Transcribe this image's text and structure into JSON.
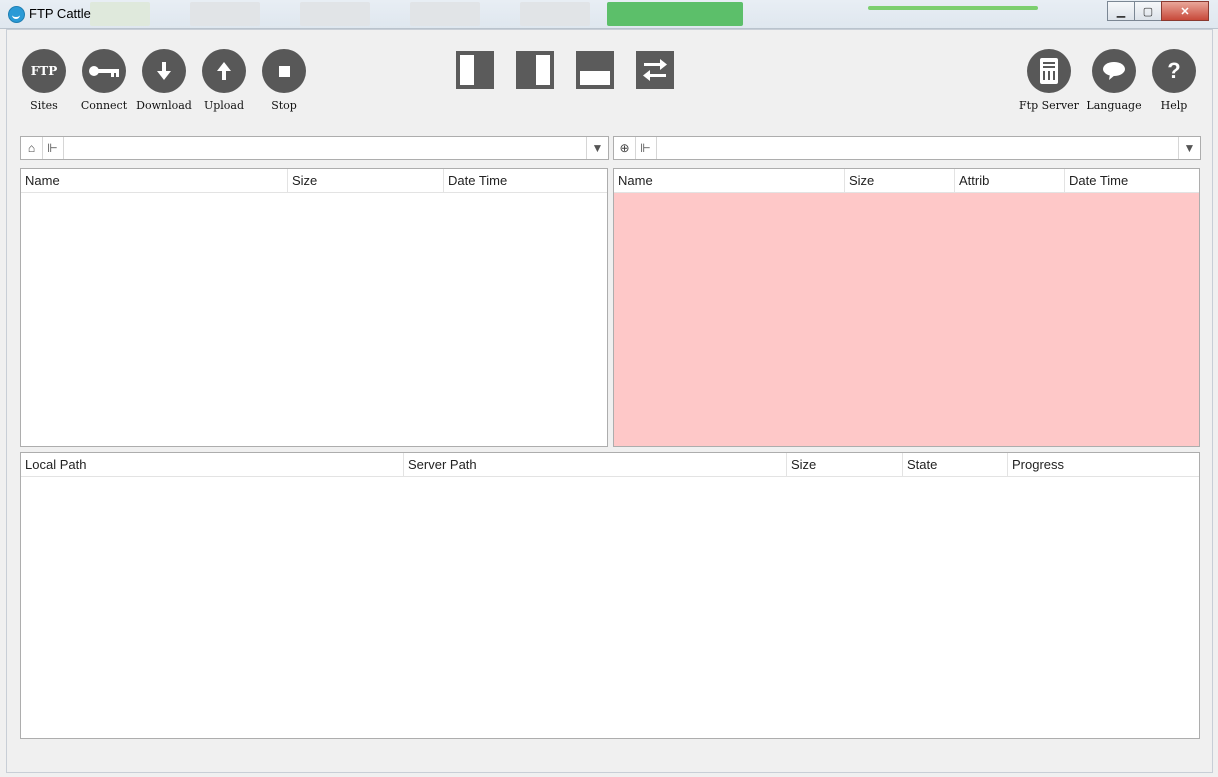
{
  "window": {
    "title": "FTP Cattle",
    "controls": [
      "minimize",
      "maximize",
      "close"
    ]
  },
  "toolbar": {
    "left": [
      {
        "label": "Sites",
        "icon": "ftp-icon",
        "glyph": "FTP"
      },
      {
        "label": "Connect",
        "icon": "key-icon",
        "glyph": "⚷"
      },
      {
        "label": "Download",
        "icon": "download-arrow-icon",
        "glyph": "⬇"
      },
      {
        "label": "Upload",
        "icon": "upload-arrow-icon",
        "glyph": "⬆"
      },
      {
        "label": "Stop",
        "icon": "stop-icon",
        "glyph": "■"
      }
    ],
    "layout_buttons": [
      "left-pane-layout",
      "right-pane-layout",
      "bottom-pane-layout",
      "swap-panes"
    ],
    "right": [
      {
        "label": "Ftp Server",
        "icon": "server-icon",
        "glyph": "▤"
      },
      {
        "label": "Language",
        "icon": "speech-bubble-icon",
        "glyph": "●"
      },
      {
        "label": "Help",
        "icon": "help-icon",
        "glyph": "?"
      }
    ]
  },
  "local": {
    "path_value": "",
    "columns": [
      "Name",
      "Size",
      "Date Time"
    ]
  },
  "remote": {
    "path_value": "",
    "columns": [
      "Name",
      "Size",
      "Attrib",
      "Date Time"
    ],
    "background": "#fec8c8"
  },
  "queue": {
    "columns": [
      "Local Path",
      "Server Path",
      "Size",
      "State",
      "Progress"
    ]
  }
}
